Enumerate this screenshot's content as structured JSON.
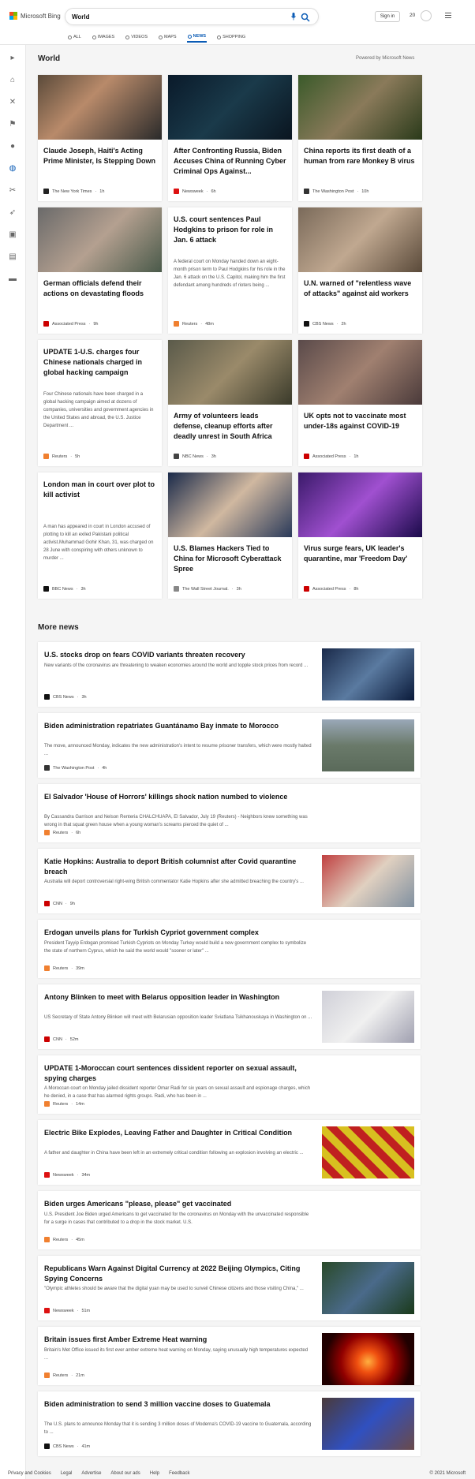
{
  "header": {
    "logo_text": "Microsoft Bing",
    "search_value": "World",
    "signin_label": "Sign in",
    "points": "20",
    "tabs": [
      {
        "label": "ALL",
        "icon": "search-icon"
      },
      {
        "label": "IMAGES",
        "icon": "image-icon"
      },
      {
        "label": "VIDEOS",
        "icon": "video-icon"
      },
      {
        "label": "MAPS",
        "icon": "map-pin-icon"
      },
      {
        "label": "NEWS",
        "icon": "news-icon"
      },
      {
        "label": "SHOPPING",
        "icon": "shopping-bag-icon"
      }
    ],
    "active_tab": "NEWS"
  },
  "rail": {
    "items": [
      "expand-icon",
      "home-icon",
      "tools-icon",
      "flag-icon",
      "location-pin-icon",
      "globe-icon",
      "tools-icon",
      "rocket-icon",
      "entertainment-icon",
      "bank-icon",
      "card-icon"
    ],
    "active": "globe-icon"
  },
  "world": {
    "title": "World",
    "powered": "Powered by Microsoft News",
    "cards": [
      {
        "title": "Claude Joseph, Haiti's Acting Prime Minister, Is Stepping Down",
        "source": "The New York Times",
        "age": "1h",
        "src_class": "nyt",
        "has_img": true,
        "img": "linear-gradient(135deg,#5a4a3a,#b88a6a 40%,#2a2a2a)"
      },
      {
        "title": "After Confronting Russia, Biden Accuses China of Running Cyber Criminal Ops Against...",
        "source": "Newsweek",
        "age": "6h",
        "src_class": "nw",
        "has_img": true,
        "img": "linear-gradient(135deg,#0a1a2a,#1a3a4a 50%,#0a1520)"
      },
      {
        "title": "China reports its first death of a human from rare Monkey B virus",
        "source": "The Washington Post",
        "age": "10h",
        "src_class": "wp",
        "has_img": true,
        "img": "linear-gradient(135deg,#3a5a2a,#8a7a5a 50%,#2a3a1a)"
      },
      {
        "title": "German officials defend their actions on devastating floods",
        "source": "Associated Press",
        "age": "9h",
        "src_class": "ap",
        "has_img": true,
        "img": "linear-gradient(135deg,#6a6a6a,#b4a090 50%,#4a5a4a)"
      },
      {
        "title": "U.S. court sentences Paul Hodgkins to prison for role in Jan. 6 attack",
        "desc": "A federal court on Monday handed down an eight-month prison term to Paul Hodgkins for his role in the Jan. 6 attack on the U.S. Capitol, making him the first defendant among hundreds of rioters being ...",
        "source": "Reuters",
        "age": "48m",
        "src_class": "ru",
        "has_img": false
      },
      {
        "title": "U.N. warned of \"relentless wave of attacks\" against aid workers",
        "source": "CBS News",
        "age": "2h",
        "src_class": "cbs",
        "has_img": true,
        "img": "linear-gradient(135deg,#7a6a5a,#c0a890 50%,#5a4a3a)"
      },
      {
        "title": "UPDATE 1-U.S. charges four Chinese nationals charged in global hacking campaign",
        "desc": "Four Chinese nationals have been charged in a global hacking campaign aimed at dozens of companies, universities and government agencies in the United States and abroad, the U.S. Justice Department ...",
        "source": "Reuters",
        "age": "5h",
        "src_class": "ru",
        "has_img": false
      },
      {
        "title": "Army of volunteers leads defense, cleanup efforts after deadly unrest in South Africa",
        "source": "NBC News",
        "age": "3h",
        "src_class": "nbc",
        "has_img": true,
        "img": "linear-gradient(135deg,#5a5a4a,#9a8a6a 50%,#3a3a2a)"
      },
      {
        "title": "UK opts not to vaccinate most under-18s against COVID-19",
        "source": "Associated Press",
        "age": "1h",
        "src_class": "ap",
        "has_img": true,
        "img": "linear-gradient(135deg,#5a4a4a,#a08070 50%,#4a3a3a)"
      },
      {
        "title": "London man in court over plot to kill activist",
        "desc": "A man has appeared in court in London accused of plotting to kill an exiled Pakistani political activist.Muhammad Gohir Khan, 31, was charged on 28 June with conspiring with others unknown to murder ...",
        "source": "BBC News",
        "age": "3h",
        "src_class": "bbc",
        "has_img": false
      },
      {
        "title": "U.S. Blames Hackers Tied to China for Microsoft Cyberattack Spree",
        "source": "The Wall Street Journal.",
        "age": "3h",
        "src_class": "wsj",
        "has_img": true,
        "img": "linear-gradient(135deg,#1a2a4a,#d0b8a0 50%,#2a3a5a)"
      },
      {
        "title": "Virus surge fears, UK leader's quarantine, mar 'Freedom Day'",
        "source": "Associated Press",
        "age": "8h",
        "src_class": "ap",
        "has_img": true,
        "img": "linear-gradient(135deg,#3a1a6a,#a050d0 50%,#1a0a4a)"
      }
    ]
  },
  "more": {
    "title": "More news",
    "items": [
      {
        "title": "U.S. stocks drop on fears COVID variants threaten recovery",
        "desc": "New variants of the coronavirus are threatening to weaken economies around the world and topple stock prices from record ...",
        "source": "CBS News",
        "age": "3h",
        "src_class": "cbs",
        "has_img": true,
        "img": "linear-gradient(135deg,#1a2a4a,#5a7aa0 50%,#0a1a3a)"
      },
      {
        "title": "Biden administration repatriates Guantánamo Bay inmate to Morocco",
        "desc": "The move, announced Monday, indicates the new administration's intent to resume prisoner transfers, which were mostly halted ...",
        "source": "The Washington Post",
        "age": "4h",
        "src_class": "wp",
        "has_img": true,
        "img": "linear-gradient(180deg,#9aa8b8,#6a7a6a 50%,#5a6a5a)"
      },
      {
        "title": "El Salvador 'House of Horrors' killings shock nation numbed to violence",
        "desc": "By Cassandra Garrison and Nelson Renteria CHALCHUAPA, El Salvador, July 19 (Reuters) - Neighbors knew something was wrong in that squat green house when a young woman's screams pierced the quiet of ...",
        "source": "Reuters",
        "age": "6h",
        "src_class": "ru",
        "has_img": false
      },
      {
        "title": "Katie Hopkins: Australia to deport British columnist after Covid quarantine breach",
        "desc": "Australia will deport controversial right-wing British commentator Katie Hopkins after she admitted breaching the country's ...",
        "source": "CNN",
        "age": "9h",
        "src_class": "cnn",
        "has_img": true,
        "img": "linear-gradient(135deg,#c04040,#e0d0c0 50%,#8090a0)"
      },
      {
        "title": "Erdogan unveils plans for Turkish Cypriot government complex",
        "desc": "President Tayyip Erdogan promised Turkish Cypriots on Monday Turkey would build a new government complex to symbolize the state of northern Cyprus, which he said the world would \"sooner or later\" ...",
        "source": "Reuters",
        "age": "39m",
        "src_class": "ru",
        "has_img": false
      },
      {
        "title": "Antony Blinken to meet with Belarus opposition leader in Washington",
        "desc": "US Secretary of State Antony Blinken will meet with Belarusian opposition leader Sviatlana Tsikhanouskaya in Washington on ...",
        "source": "CNN",
        "age": "52m",
        "src_class": "cnn",
        "has_img": true,
        "img": "linear-gradient(135deg,#d0d0d8,#f0f0f0 50%,#a0a0b0)"
      },
      {
        "title": "UPDATE 1-Moroccan court sentences dissident reporter on sexual assault, spying charges",
        "desc": "A Moroccan court on Monday jailed dissident reporter Omar Radi for six years on sexual assault and espionage charges, which he denied, in a case that has alarmed rights groups. Radi, who has been in ...",
        "source": "Reuters",
        "age": "14m",
        "src_class": "ru",
        "has_img": false
      },
      {
        "title": "Electric Bike Explodes, Leaving Father and Daughter in Critical Condition",
        "desc": "A father and daughter in China have been left in an extremely critical condition following an explosion involving an electric ...",
        "source": "Newsweek",
        "age": "34m",
        "src_class": "nw",
        "has_img": true,
        "img": "repeating-linear-gradient(45deg,#d8c020 0 10px,#c02020 10px 20px)"
      },
      {
        "title": "Biden urges Americans \"please, please\" get vaccinated",
        "desc": "U.S. President Joe Biden urged Americans to get vaccinated for the coronavirus on Monday with the unvaccinated responsible for a surge in cases that contributed to a drop in the stock market. U.S.",
        "source": "Reuters",
        "age": "45m",
        "src_class": "ru",
        "has_img": false
      },
      {
        "title": "Republicans Warn Against Digital Currency at 2022 Beijing Olympics, Citing Spying Concerns",
        "desc": "\"Olympic athletes should be aware that the digital yuan may be used to surveil Chinese citizens and those visiting China,\" ...",
        "source": "Newsweek",
        "age": "51m",
        "src_class": "nw",
        "has_img": true,
        "img": "linear-gradient(135deg,#2a4a2a,#4a6a8a 50%,#1a3a1a)"
      },
      {
        "title": "Britain issues first Amber Extreme Heat warning",
        "desc": "Britain's Met Office issued its first ever amber extreme heat warning on Monday, saying unusually high temperatures expected ...",
        "source": "Reuters",
        "age": "21m",
        "src_class": "ru",
        "has_img": true,
        "img": "radial-gradient(circle at 50% 55%,#ffb040 0,#f05010 20%,#900000 50%,#200000 80%)"
      },
      {
        "title": "Biden administration to send 3 million vaccine doses to Guatemala",
        "desc": "The U.S. plans to announce Monday that it is sending 3 million doses of Moderna's COVID-19 vaccine to Guatemala, according to ...",
        "source": "CBS News",
        "age": "41m",
        "src_class": "cbs",
        "has_img": true,
        "img": "linear-gradient(135deg,#4a3a3a,#3050c0 50%,#6a4a4a)"
      }
    ]
  },
  "footer": {
    "links": [
      "Privacy and Cookies",
      "Legal",
      "Advertise",
      "About our ads",
      "Help",
      "Feedback"
    ],
    "copyright": "© 2021 Microsoft"
  }
}
